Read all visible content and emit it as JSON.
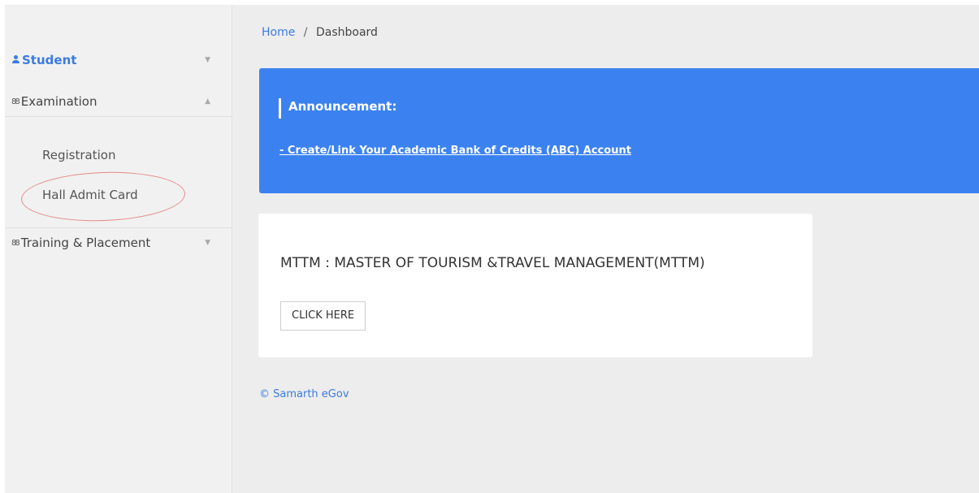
{
  "sidebar": {
    "student_label": "Student",
    "examination_label": "Examination",
    "submenu": {
      "registration": "Registration",
      "hall_admit_card": "Hall Admit Card"
    },
    "training_label": "Training & Placement",
    "caret_down": "▼",
    "caret_up": "▲",
    "users_glyph": "88"
  },
  "breadcrumb": {
    "home": "Home",
    "separator": "/",
    "current": "Dashboard"
  },
  "announcement": {
    "title": "Announcement:",
    "link_text": "- Create/Link Your Academic Bank of Credits (ABC) Account"
  },
  "card": {
    "course": "MTTM : MASTER OF TOURISM &TRAVEL MANAGEMENT(MTTM)",
    "button_label": "CLICK HERE"
  },
  "footer": {
    "text": "© Samarth eGov"
  },
  "colors": {
    "accent": "#3b7be0",
    "announcement_bg": "#3b82f0",
    "annotation_circle": "#e48a8a"
  }
}
